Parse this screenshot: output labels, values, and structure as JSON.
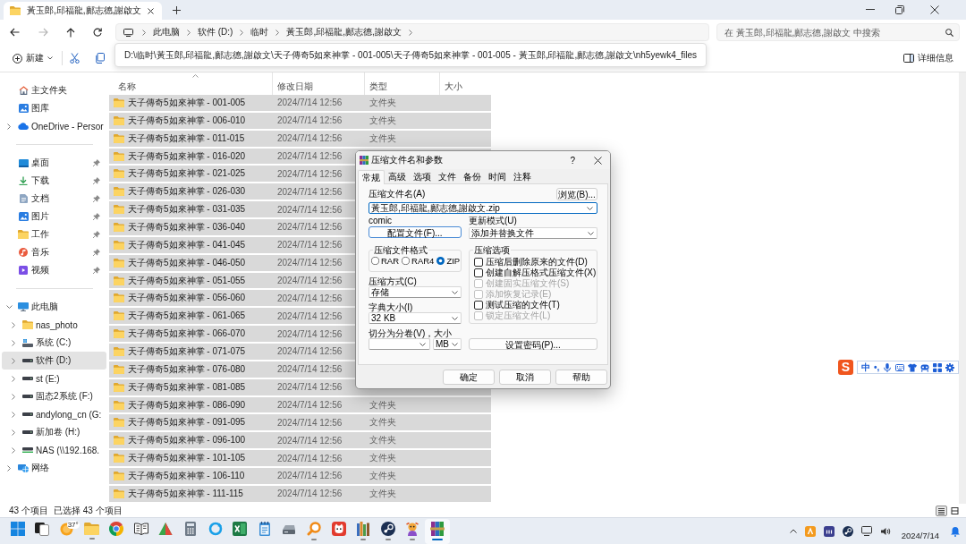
{
  "window": {
    "title": "黃玉郎,邱福龍,鄺志德,謝啟文"
  },
  "address_bar": {
    "crumbs": [
      "此电脑",
      "软件 (D:)",
      "临时",
      "黃玉郎,邱福龍,鄺志德,謝啟文"
    ]
  },
  "search": {
    "placeholder": "在 黃玉郎,邱福龍,鄺志德,謝啟文 中搜索"
  },
  "toolbar": {
    "new_button": "新建",
    "details_button": "详细信息"
  },
  "path_tooltip": "D:\\临时\\黃玉郎,邱福龍,鄺志德,謝啟文\\天子傳奇5如來神掌 - 001-005\\天子傳奇5如來神掌 - 001-005 - 黃玉郎,邱福龍,鄺志德,謝啟文\\nh5yewk4_files",
  "sidebar": {
    "sections": [
      {
        "items": [
          {
            "label": "主文件夹",
            "kind": "home",
            "selected": false
          },
          {
            "label": "图库",
            "kind": "gallery",
            "selected": false
          },
          {
            "label": "OneDrive - Persor",
            "kind": "cloud",
            "expanded": false,
            "selected": false
          }
        ]
      },
      {
        "items": [
          {
            "label": "桌面",
            "kind": "desktop",
            "pinned": true,
            "selected": false
          },
          {
            "label": "下载",
            "kind": "download",
            "pinned": true,
            "selected": false
          },
          {
            "label": "文档",
            "kind": "document",
            "pinned": true,
            "selected": false
          },
          {
            "label": "图片",
            "kind": "pictures",
            "pinned": true,
            "selected": false
          },
          {
            "label": "工作",
            "kind": "folder",
            "pinned": true,
            "selected": false
          },
          {
            "label": "音乐",
            "kind": "music",
            "pinned": true,
            "selected": false
          },
          {
            "label": "视频",
            "kind": "video",
            "pinned": true,
            "selected": false
          }
        ]
      },
      {
        "items": [
          {
            "label": "此电脑",
            "kind": "computer",
            "expanded": true,
            "selected": false,
            "children": [
              {
                "label": "nas_photo",
                "kind": "folder",
                "expanded": false,
                "selected": false
              },
              {
                "label": "系统 (C:)",
                "kind": "system_drive",
                "expanded": false,
                "selected": false
              },
              {
                "label": "软件 (D:)",
                "kind": "drive",
                "expanded": false,
                "selected": true
              },
              {
                "label": "st (E:)",
                "kind": "drive",
                "expanded": false,
                "selected": false
              },
              {
                "label": "固态2系统 (F:)",
                "kind": "drive",
                "expanded": false,
                "selected": false
              },
              {
                "label": "andylong_cn (G:",
                "kind": "drive",
                "expanded": false,
                "selected": false
              },
              {
                "label": "新加卷 (H:)",
                "kind": "drive",
                "expanded": false,
                "selected": false
              },
              {
                "label": "NAS (\\\\192.168.",
                "kind": "network_drive",
                "expanded": false,
                "selected": false
              }
            ]
          },
          {
            "label": "网络",
            "kind": "network",
            "expanded": false,
            "selected": false
          }
        ]
      }
    ]
  },
  "file_list": {
    "columns": [
      {
        "label": "名称",
        "sorted": true
      },
      {
        "label": "修改日期",
        "sorted": false
      },
      {
        "label": "类型",
        "sorted": false
      },
      {
        "label": "大小",
        "sorted": false
      }
    ],
    "rows": [
      {
        "name": "天子傳奇5如來神掌 - 001-005",
        "modified": "2024/7/14 12:56",
        "type": "文件夹",
        "selected": true
      },
      {
        "name": "天子傳奇5如來神掌 - 006-010",
        "modified": "2024/7/14 12:56",
        "type": "文件夹",
        "selected": true
      },
      {
        "name": "天子傳奇5如來神掌 - 011-015",
        "modified": "2024/7/14 12:56",
        "type": "文件夹",
        "selected": true
      },
      {
        "name": "天子傳奇5如來神掌 - 016-020",
        "modified": "2024/7/14 12:56",
        "selected": true
      },
      {
        "name": "天子傳奇5如來神掌 - 021-025",
        "modified": "2024/7/14 12:56",
        "selected": true
      },
      {
        "name": "天子傳奇5如來神掌 - 026-030",
        "modified": "2024/7/14 12:56",
        "selected": true
      },
      {
        "name": "天子傳奇5如來神掌 - 031-035",
        "modified": "2024/7/14 12:56",
        "selected": true
      },
      {
        "name": "天子傳奇5如來神掌 - 036-040",
        "modified": "2024/7/14 12:56",
        "selected": true
      },
      {
        "name": "天子傳奇5如來神掌 - 041-045",
        "modified": "2024/7/14 12:56",
        "selected": true
      },
      {
        "name": "天子傳奇5如來神掌 - 046-050",
        "modified": "2024/7/14 12:56",
        "selected": true
      },
      {
        "name": "天子傳奇5如來神掌 - 051-055",
        "modified": "2024/7/14 12:56",
        "selected": true
      },
      {
        "name": "天子傳奇5如來神掌 - 056-060",
        "modified": "2024/7/14 12:56",
        "selected": true
      },
      {
        "name": "天子傳奇5如來神掌 - 061-065",
        "modified": "2024/7/14 12:56",
        "selected": true
      },
      {
        "name": "天子傳奇5如來神掌 - 066-070",
        "modified": "2024/7/14 12:56",
        "selected": true
      },
      {
        "name": "天子傳奇5如來神掌 - 071-075",
        "modified": "2024/7/14 12:56",
        "selected": true
      },
      {
        "name": "天子傳奇5如來神掌 - 076-080",
        "modified": "2024/7/14 12:56",
        "selected": true
      },
      {
        "name": "天子傳奇5如來神掌 - 081-085",
        "modified": "2024/7/14 12:56",
        "selected": true
      },
      {
        "name": "天子傳奇5如來神掌 - 086-090",
        "modified": "2024/7/14 12:56",
        "type": "文件夹",
        "selected": true
      },
      {
        "name": "天子傳奇5如來神掌 - 091-095",
        "modified": "2024/7/14 12:56",
        "type": "文件夹",
        "selected": true
      },
      {
        "name": "天子傳奇5如來神掌 - 096-100",
        "modified": "2024/7/14 12:56",
        "type": "文件夹",
        "selected": true
      },
      {
        "name": "天子傳奇5如來神掌 - 101-105",
        "modified": "2024/7/14 12:56",
        "type": "文件夹",
        "selected": true
      },
      {
        "name": "天子傳奇5如來神掌 - 106-110",
        "modified": "2024/7/14 12:56",
        "type": "文件夹",
        "selected": true
      },
      {
        "name": "天子傳奇5如來神掌 - 111-115",
        "modified": "2024/7/14 12:56",
        "type": "文件夹",
        "selected": true
      }
    ]
  },
  "status_bar": {
    "item_count": "43 个项目",
    "selection": "已选择 43 个项目",
    "views": [
      {
        "kind": "details",
        "selected": true
      },
      {
        "kind": "tiles",
        "selected": false
      }
    ]
  },
  "dialog": {
    "title": "压缩文件名和参数",
    "help": "?",
    "tabs": [
      {
        "label": "常规",
        "selected": true
      },
      {
        "label": "高级",
        "selected": false
      },
      {
        "label": "选项",
        "selected": false
      },
      {
        "label": "文件",
        "selected": false
      },
      {
        "label": "备份",
        "selected": false
      },
      {
        "label": "时间",
        "selected": false
      },
      {
        "label": "注释",
        "selected": false
      }
    ],
    "archive_name_label": "压缩文件名(A)",
    "browse_button": "浏览(B)...",
    "archive_name": "黃玉郎,邱福龍,鄺志德,謝啟文.zip",
    "profile_label": "comic",
    "profiles_button": "配置文件(F)...",
    "update_mode_label": "更新模式(U)",
    "update_mode": "添加并替换文件",
    "format": {
      "title": "压缩文件格式",
      "options": [
        {
          "label": "RAR",
          "selected": false
        },
        {
          "label": "RAR4",
          "selected": false
        },
        {
          "label": "ZIP",
          "selected": true
        }
      ]
    },
    "method_label": "压缩方式(C)",
    "method": "存储",
    "dictionary_label": "字典大小(I)",
    "dictionary": "32 KB",
    "split_label": "切分为分卷(V)，大小",
    "split_unit": "MB",
    "options": {
      "title": "压缩选项",
      "items": [
        {
          "label": "压缩后删除原来的文件(D)",
          "checked": false,
          "disabled": false
        },
        {
          "label": "创建自解压格式压缩文件(X)",
          "checked": false,
          "disabled": false
        },
        {
          "label": "创建固实压缩文件(S)",
          "checked": false,
          "disabled": true
        },
        {
          "label": "添加恢复记录(E)",
          "checked": false,
          "disabled": true
        },
        {
          "label": "测试压缩的文件(T)",
          "checked": false,
          "disabled": false
        },
        {
          "label": "锁定压缩文件(L)",
          "checked": false,
          "disabled": true
        }
      ]
    },
    "password_button": "设置密码(P)...",
    "buttons": [
      "确定",
      "取消",
      "帮助"
    ]
  },
  "ime_toolbar": {
    "logo": "S",
    "mode": "中",
    "punctuation": "•,"
  },
  "taskbar": {
    "apps": [
      {
        "kind": "start",
        "running": false,
        "active": false
      },
      {
        "kind": "task_view",
        "running": false,
        "active": false
      },
      {
        "kind": "weather",
        "badge": "37°",
        "running": false,
        "active": false
      },
      {
        "kind": "folder",
        "running": true,
        "active": false
      },
      {
        "kind": "browser",
        "running": false,
        "active": false
      },
      {
        "kind": "reader",
        "running": false,
        "active": false
      },
      {
        "kind": "triangle",
        "running": false,
        "active": false
      },
      {
        "kind": "calculator",
        "running": false,
        "active": false
      },
      {
        "kind": "sync",
        "running": false,
        "active": false
      },
      {
        "kind": "spreadsheet",
        "running": false,
        "active": false
      },
      {
        "kind": "notepad",
        "running": false,
        "active": false
      },
      {
        "kind": "scanner",
        "running": false,
        "active": false
      },
      {
        "kind": "magnifier",
        "running": true,
        "active": false
      },
      {
        "kind": "cat",
        "running": false,
        "active": false
      },
      {
        "kind": "books",
        "running": true,
        "active": false
      },
      {
        "kind": "disc",
        "running": true,
        "active": false
      },
      {
        "kind": "mascot",
        "running": true,
        "active": false
      },
      {
        "kind": "archiver",
        "running": true,
        "active": true
      }
    ],
    "date": "2024/7/14"
  }
}
